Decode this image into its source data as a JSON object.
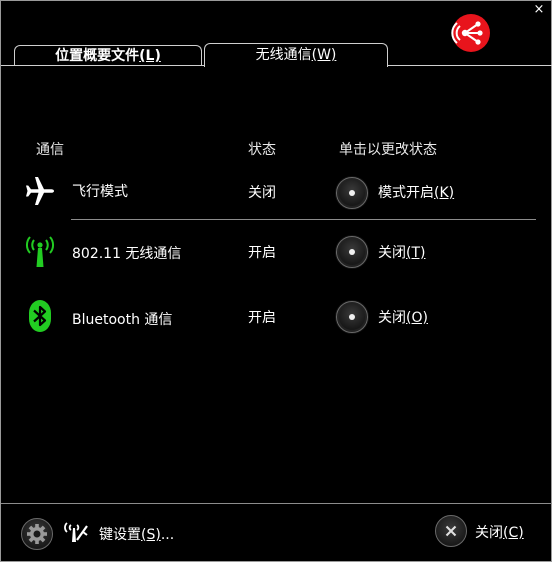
{
  "window": {
    "close_glyph": "×",
    "logo_icon": "wireless-broadcast-icon",
    "logo_color": "#e8141c"
  },
  "tabs": [
    {
      "label": "位置概要文件",
      "hotkey": "(L)",
      "active": false
    },
    {
      "label": "无线通信",
      "hotkey": "(W)",
      "active": true
    }
  ],
  "table": {
    "headers": {
      "name": "通信",
      "status": "状态",
      "action": "单击以更改状态"
    },
    "rows": [
      {
        "icon": "airplane-icon",
        "name": "飞行模式",
        "status": "关闭",
        "action_label": "模式开启",
        "action_hotkey": "(K)"
      },
      {
        "icon": "wifi-antenna-icon",
        "name": "802.11 无线通信",
        "status": "开启",
        "action_label": "关闭",
        "action_hotkey": "(T)"
      },
      {
        "icon": "bluetooth-icon",
        "name": "Bluetooth 通信",
        "status": "开启",
        "action_label": "关闭",
        "action_hotkey": "(O)"
      }
    ]
  },
  "colors": {
    "background": "#000000",
    "text": "#ffffff",
    "accent_green": "#22cc22",
    "divider": "#8c8c8c"
  },
  "footer": {
    "key_settings_label": "键设置",
    "key_settings_hotkey": "(S)",
    "key_settings_suffix": "...",
    "close_label": "关闭",
    "close_hotkey": "(C)"
  }
}
